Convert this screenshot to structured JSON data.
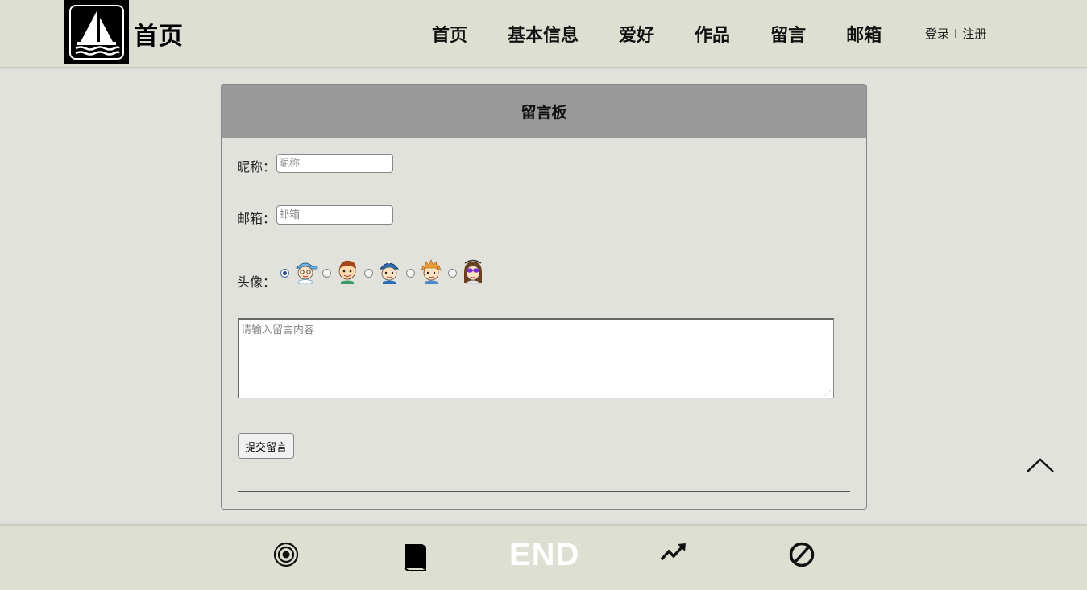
{
  "header": {
    "brand": "首页",
    "nav": [
      "首页",
      "基本信息",
      "爱好",
      "作品",
      "留言",
      "邮箱"
    ],
    "auth": {
      "login": "登录",
      "separator": "I",
      "register": "注册"
    }
  },
  "board": {
    "title": "留言板",
    "nickname": {
      "label": "昵称：",
      "placeholder": "昵称",
      "value": ""
    },
    "email": {
      "label": "邮箱：",
      "placeholder": "邮箱",
      "value": ""
    },
    "avatar": {
      "label": "头像：",
      "selected_index": 0,
      "options": [
        "avatar-1",
        "avatar-2",
        "avatar-3",
        "avatar-4",
        "avatar-5"
      ]
    },
    "message": {
      "placeholder": "请输入留言内容",
      "value": ""
    },
    "submit_label": "提交留言"
  },
  "footer": {
    "end_text": "END",
    "icons": [
      "target-icon",
      "book-icon",
      "trend-up-icon",
      "prohibited-icon"
    ]
  },
  "colors": {
    "header_bg": "#dcdfd1",
    "page_bg": "#e1e2db",
    "board_header_bg": "#999999",
    "end_text": "#ffffff"
  }
}
